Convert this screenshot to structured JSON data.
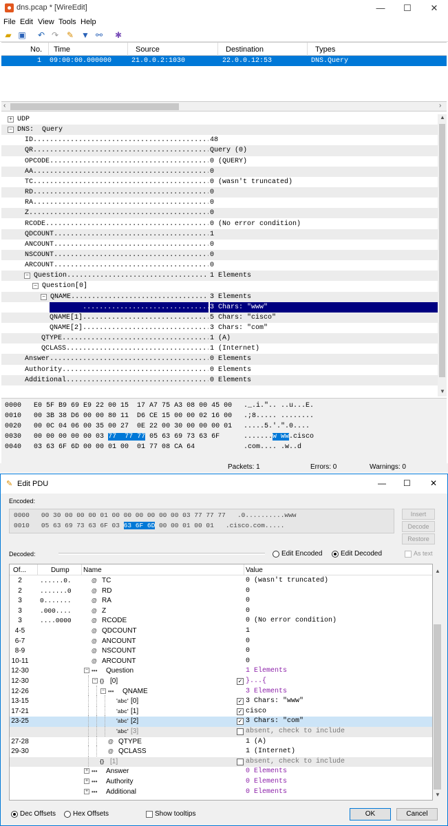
{
  "window": {
    "title": "dns.pcap * [WireEdit]",
    "minimize": "—",
    "maximize": "☐",
    "close": "✕"
  },
  "menu": [
    "File",
    "Edit",
    "View",
    "Tools",
    "Help"
  ],
  "toolbar_icons": [
    "open-folder-icon",
    "save-icon",
    "undo-icon",
    "redo-icon",
    "edit-pencil-icon",
    "filter-icon",
    "binoculars-icon",
    "settings-icon"
  ],
  "packet_list": {
    "headers": {
      "no": "No.",
      "time": "Time",
      "source": "Source",
      "destination": "Destination",
      "types": "Types"
    },
    "rows": [
      {
        "no": "1",
        "time": "09:00:00.000000",
        "source": "21.0.0.2:1030",
        "destination": "22.0.0.12:53",
        "types": "DNS.Query"
      }
    ]
  },
  "detail": [
    {
      "text": "UDP",
      "expander": "+",
      "level": 0
    },
    {
      "text": "DNS:  Query",
      "expander": "−",
      "level": 0
    },
    {
      "name": "ID",
      "value": "48",
      "level": 1
    },
    {
      "name": "QR",
      "value": "Query (0)",
      "level": 1
    },
    {
      "name": "OPCODE",
      "value": "0 (QUERY)",
      "level": 1
    },
    {
      "name": "AA",
      "value": "0",
      "level": 1
    },
    {
      "name": "TC",
      "value": "0 (wasn't truncated)",
      "level": 1
    },
    {
      "name": "RD",
      "value": "0",
      "level": 1
    },
    {
      "name": "RA",
      "value": "0",
      "level": 1
    },
    {
      "name": "Z",
      "value": "0",
      "level": 1
    },
    {
      "name": "RCODE",
      "value": "0 (No error condition)",
      "level": 1
    },
    {
      "name": "QDCOUNT",
      "value": "1",
      "level": 1
    },
    {
      "name": "ANCOUNT",
      "value": "0",
      "level": 1
    },
    {
      "name": "NSCOUNT",
      "value": "0",
      "level": 1
    },
    {
      "name": "ARCOUNT",
      "value": "0",
      "level": 1
    },
    {
      "name": "Question",
      "value": "1 Elements",
      "level": 1,
      "expander": "−"
    },
    {
      "text": "Question[0]",
      "level": 2,
      "expander": "−"
    },
    {
      "name": "QNAME",
      "value": "3 Elements",
      "level": 3,
      "expander": "−"
    },
    {
      "name": "QNAME[0]",
      "value": "3 Chars: \"www\"",
      "level": 4,
      "selected": true
    },
    {
      "name": "QNAME[1]",
      "value": "5 Chars: \"cisco\"",
      "level": 4
    },
    {
      "name": "QNAME[2]",
      "value": "3 Chars: \"com\"",
      "level": 4
    },
    {
      "name": "QTYPE",
      "value": "1 (A)",
      "level": 3
    },
    {
      "name": "QCLASS",
      "value": "1 (Internet)",
      "level": 3
    },
    {
      "name": "Answer",
      "value": "0 Elements",
      "level": 1
    },
    {
      "name": "Authority",
      "value": "0 Elements",
      "level": 1
    },
    {
      "name": "Additional",
      "value": "0 Elements",
      "level": 1
    }
  ],
  "hex": [
    {
      "offset": "0000",
      "bytes": "E0 5F B9 69 E9 22 00 15  17 A7 75 A3 08 00 45 00",
      "ascii": "._.i.\".. ..u...E."
    },
    {
      "offset": "0010",
      "bytes": "00 3B 38 D6 00 00 80 11  D6 CE 15 00 00 02 16 00",
      "ascii": ".;8..... ........"
    },
    {
      "offset": "0020",
      "bytes": "00 0C 04 06 00 35 00 27  0E 22 00 30 00 00 00 01",
      "ascii": ".....5.'.\".0...."
    },
    {
      "offset": "0030",
      "bytes_pre": "00 00 00 00 00 03 ",
      "bytes_hl": "77  77 77",
      "bytes_post": " 05 63 69 73 63 6F",
      "ascii_pre": ".......",
      "ascii_hl": "w ww",
      "ascii_post": ".cisco"
    },
    {
      "offset": "0040",
      "bytes": "03 63 6F 6D 00 00 01 00  01 77 08 CA 64",
      "ascii": ".com.... .w..d"
    }
  ],
  "status": {
    "packets": "Packets: 1",
    "errors": "Errors: 0",
    "warnings": "Warnings: 0"
  },
  "dialog": {
    "title": "Edit PDU",
    "encoded_label": "Encoded:",
    "encoded": [
      {
        "offset": "0000",
        "bytes": "00 30 00 00 00 01 00 00 00 00 00 00 03 77 77 77",
        "ascii": ".0..........www"
      },
      {
        "offset": "0010",
        "bytes_pre": "05 63 69 73 63 6F 03 ",
        "bytes_hl": "63 6F 6D",
        "bytes_post": " 00 00 01 00 01",
        "ascii": ".cisco.com....."
      }
    ],
    "side_buttons": [
      "Insert",
      "Decode",
      "Restore"
    ],
    "decoded_label": "Decoded:",
    "edit_encoded": "Edit Encoded",
    "edit_decoded": "Edit Decoded",
    "as_text": "As text",
    "grid_headers": {
      "offsets": "Of...",
      "dump": "Dump",
      "name": "Name",
      "value": "Value"
    },
    "grid_rows": [
      {
        "off": "2",
        "dump": "......0.",
        "icon": "@",
        "name": "TC",
        "value": "0 (wasn't truncated)",
        "indent": 0
      },
      {
        "off": "2",
        "dump": ".......0",
        "icon": "@",
        "name": "RD",
        "value": "0",
        "indent": 0
      },
      {
        "off": "3",
        "dump": "0.......",
        "icon": "@",
        "name": "RA",
        "value": "0",
        "indent": 0
      },
      {
        "off": "3",
        "dump": ".000....",
        "icon": "@",
        "name": "Z",
        "value": "0",
        "indent": 0
      },
      {
        "off": "3",
        "dump": "....0000",
        "icon": "@",
        "name": "RCODE",
        "value": "0 (No error condition)",
        "indent": 0
      },
      {
        "off": "4-5",
        "dump": "",
        "icon": "@",
        "name": "QDCOUNT",
        "value": "1",
        "indent": 0
      },
      {
        "off": "6-7",
        "dump": "",
        "icon": "@",
        "name": "ANCOUNT",
        "value": "0",
        "indent": 0
      },
      {
        "off": "8-9",
        "dump": "",
        "icon": "@",
        "name": "NSCOUNT",
        "value": "0",
        "indent": 0
      },
      {
        "off": "10-11",
        "dump": "",
        "icon": "@",
        "name": "ARCOUNT",
        "value": "0",
        "indent": 0
      },
      {
        "off": "12-30",
        "dump": "",
        "icon": "•••",
        "name": "Question",
        "value": "1 Elements",
        "indent": 0,
        "expander": "−",
        "purple": true
      },
      {
        "off": "12-30",
        "dump": "",
        "icon": "{}",
        "name": "[0]",
        "value": "}...{",
        "indent": 1,
        "expander": "−",
        "purple": true,
        "check": "✓"
      },
      {
        "off": "12-26",
        "dump": "",
        "icon": "•••",
        "name": "QNAME",
        "value": "3 Elements",
        "indent": 2,
        "expander": "−",
        "purple": true
      },
      {
        "off": "13-15",
        "dump": "",
        "icon": "'abc'",
        "name": "[0]",
        "value": "3 Chars: \"www\"",
        "indent": 3,
        "check": "✓"
      },
      {
        "off": "17-21",
        "dump": "",
        "icon": "'abc'",
        "name": "[1]",
        "value": "cisco",
        "indent": 3,
        "check": "✓"
      },
      {
        "off": "23-25",
        "dump": "",
        "icon": "'abc'",
        "name": "[2]",
        "value": "3 Chars: \"com\"",
        "indent": 3,
        "check": "✓",
        "selected": true
      },
      {
        "off": "",
        "dump": "",
        "icon": "'abc'",
        "name": "[3]",
        "value": "absent, check to include",
        "indent": 3,
        "check": "",
        "absent": true
      },
      {
        "off": "27-28",
        "dump": "",
        "icon": "@",
        "name": "QTYPE",
        "value": "1 (A)",
        "indent": 2
      },
      {
        "off": "29-30",
        "dump": "",
        "icon": "@",
        "name": "QCLASS",
        "value": "1 (Internet)",
        "indent": 2
      },
      {
        "off": "",
        "dump": "",
        "icon": "{}",
        "name": "[1]",
        "value": "absent, check to include",
        "indent": 1,
        "check": "",
        "absent": true
      },
      {
        "off": "",
        "dump": "",
        "icon": "•••",
        "name": "Answer",
        "value": "0 Elements",
        "indent": 0,
        "expander": "+",
        "purple": true
      },
      {
        "off": "",
        "dump": "",
        "icon": "•••",
        "name": "Authority",
        "value": "0 Elements",
        "indent": 0,
        "expander": "+",
        "purple": true
      },
      {
        "off": "",
        "dump": "",
        "icon": "•••",
        "name": "Additional",
        "value": "0 Elements",
        "indent": 0,
        "expander": "+",
        "purple": true
      }
    ],
    "dec_offsets": "Dec Offsets",
    "hex_offsets": "Hex Offsets",
    "show_tooltips": "Show tooltips",
    "ok": "OK",
    "cancel": "Cancel"
  },
  "colors": {
    "selection": "#0078d7",
    "tree_selection": "#000080",
    "purple": "#8b1fa8"
  }
}
